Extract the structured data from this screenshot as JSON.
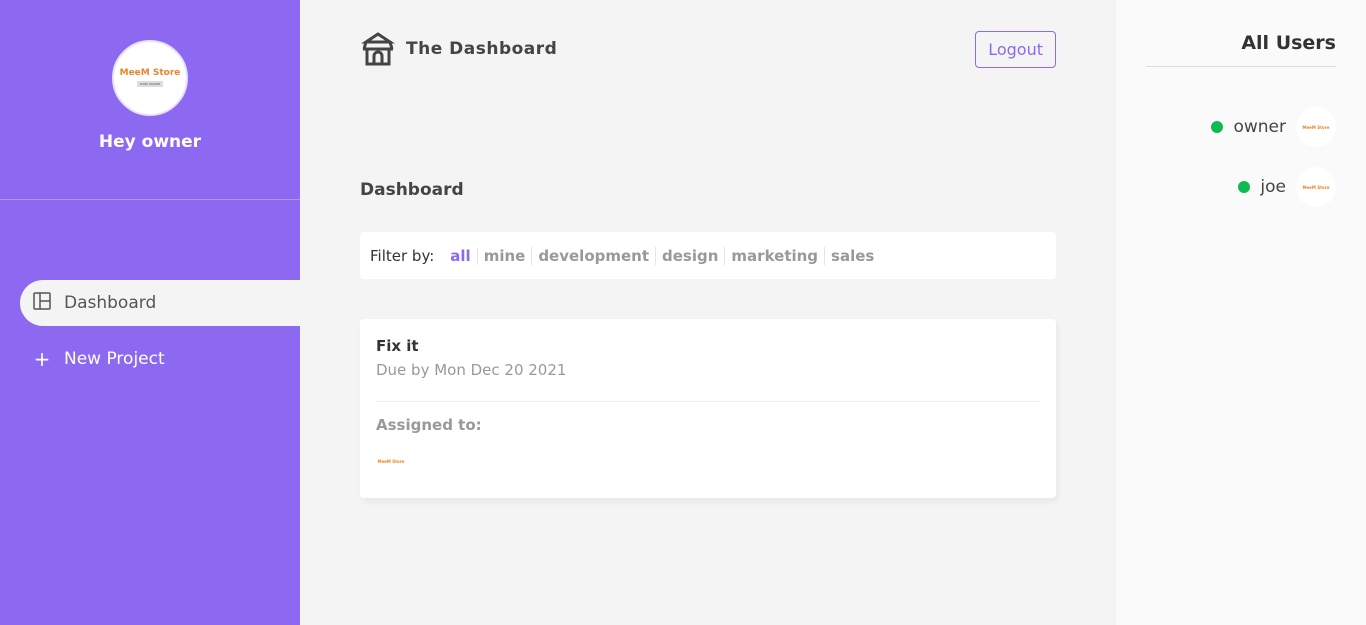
{
  "sidebar": {
    "logo_text": "MeeM Store",
    "logo_sub": "SHOP ONLINE",
    "greeting": "Hey owner",
    "items": [
      {
        "label": "Dashboard",
        "icon": "layout-icon",
        "active": true
      },
      {
        "label": "New Project",
        "icon": "plus-icon"
      }
    ]
  },
  "header": {
    "title": "The Dashboard",
    "logout": "Logout"
  },
  "main": {
    "heading": "Dashboard",
    "filter_label": "Filter by:",
    "filters": [
      "all",
      "mine",
      "development",
      "design",
      "marketing",
      "sales"
    ],
    "active_filter": "all",
    "projects": [
      {
        "name": "Fix it",
        "due": "Due by Mon Dec 20 2021",
        "assigned_label": "Assigned to:"
      }
    ]
  },
  "users": {
    "title": "All Users",
    "list": [
      {
        "name": "owner",
        "online": true
      },
      {
        "name": "joe",
        "online": true
      }
    ]
  },
  "colors": {
    "accent": "#8d69f1",
    "online": "#0ebb50"
  }
}
